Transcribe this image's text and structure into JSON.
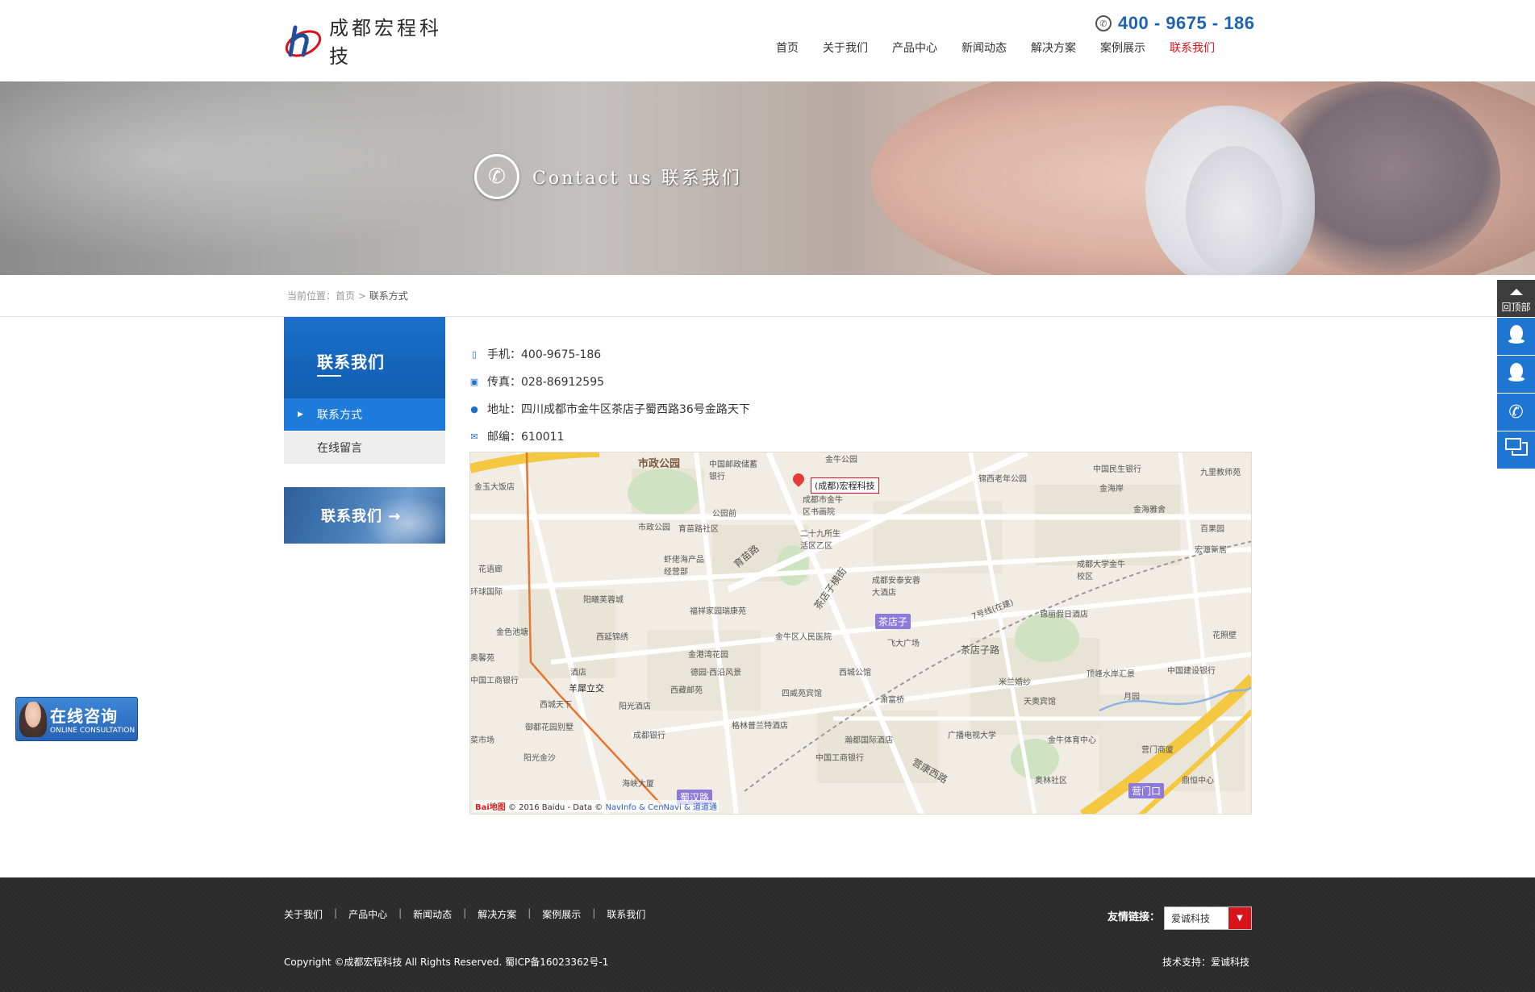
{
  "header": {
    "logo_text": "成都宏程科技",
    "hotline": "400 - 9675 - 186",
    "nav": [
      {
        "label": "首页"
      },
      {
        "label": "关于我们"
      },
      {
        "label": "产品中心"
      },
      {
        "label": "新闻动态"
      },
      {
        "label": "解决方案"
      },
      {
        "label": "案例展示"
      },
      {
        "label": "联系我们",
        "active": true
      }
    ]
  },
  "banner": {
    "title": "Contact us 联系我们"
  },
  "breadcrumb": {
    "prefix": "当前位置：",
    "home": "首页",
    "sep": ">",
    "current": "联系方式"
  },
  "sidebar": {
    "title": "联系我们",
    "items": [
      {
        "label": "联系方式",
        "active": true
      },
      {
        "label": "在线留言",
        "active": false
      }
    ],
    "cta": "联系我们 →"
  },
  "contact": {
    "mobile": "手机：400-9675-186",
    "fax": "传真：028-86912595",
    "address": "地址：四川成都市金牛区茶店子蜀西路36号金路天下",
    "postcode": "邮编：610011"
  },
  "map": {
    "marker": "(成都)宏程科技",
    "copyright_brand": "Bai地图",
    "copyright": "© 2016 Baidu - Data ©",
    "copyright_links": "NavInfo & CenNavi & 道道通",
    "labels": {
      "park": "市政公园",
      "l1": "中国邮政储蓄银行",
      "l2": "金牛公园",
      "l3": "锦西老年公园",
      "l4": "中国民生银行",
      "l5": "九里教师苑",
      "l6": "金海岸",
      "l7": "金海雅舍",
      "l8": "百果园",
      "l9": "宏源新居",
      "l10": "金玉大饭店",
      "l11": "成都市金牛区书画院",
      "l12": "公园前",
      "l13": "市政公园",
      "l14": "育苗路社区",
      "l15": "二十九所生活区乙区",
      "l16": "虾佬海产品经营部",
      "l17": "育苗路",
      "l18": "花语廊",
      "l19": "成都大学金牛校区",
      "l20": "环球国际",
      "l21": "阳曦芙蓉城",
      "l22": "福祥家园瑞康苑",
      "l23": "茶店子横街",
      "l24": "成都安泰安蓉大酒店",
      "l25": "锦丽假日酒店",
      "l26": "金色池塘",
      "l27": "西延锦绣",
      "l28": "金牛区人民医院",
      "l29": "飞大广场",
      "l30": "茶店子路",
      "l31": "花照壁",
      "l32": "奥馨苑",
      "l33": "金港湾花园",
      "l34": "德园·西沿风景",
      "l35": "西城公馆",
      "l36": "米兰婚纱",
      "l37": "顶峰水岸汇景",
      "l38": "中国建设银行",
      "l39": "中国工商银行",
      "l40": "羊犀立交",
      "l41": "酒店",
      "l42": "西藏邮苑",
      "l43": "四威苑宾馆",
      "l44": "渝富桥",
      "l45": "天奥宾馆",
      "l46": "月园",
      "l47": "西城天下",
      "l48": "阳光酒店",
      "l49": "御都花园别墅",
      "l50": "格林普兰特酒店",
      "l51": "广播电视大学",
      "l52": "金牛体育中心",
      "l53": "营门商厦",
      "l54": "菜市场",
      "l55": "成都银行",
      "l56": "瀚都国际酒店",
      "l57": "阳光金沙",
      "l58": "中国工商银行",
      "l59": "营康西路",
      "l60": "奥林社区",
      "l61": "鼎恒中心",
      "l62": "海峡大厦",
      "l63": "7号线(在建)"
    },
    "badges": {
      "b1": "茶店子",
      "b2": "蜀汉路",
      "b3": "营门口"
    }
  },
  "floating": {
    "online_title": "在线咨询",
    "online_sub": "ONLINE CONSULTATION",
    "back_top": "回顶部"
  },
  "footer": {
    "links": [
      "关于我们",
      "产品中心",
      "新闻动态",
      "解决方案",
      "案例展示",
      "联系我们"
    ],
    "separator": "|",
    "copyright": "Copyright ©成都宏程科技 All Rights Reserved. 蜀ICP备16023362号-1",
    "friend_label": "友情链接：",
    "friend_value": "爱诚科技",
    "tech_support": "技术支持：爱诚科技"
  },
  "colors": {
    "brand_blue": "#1d63b4",
    "active_red": "#d7141a",
    "sidebar_blue": "#1d7bdc",
    "footer_bg": "#2b2b2b"
  }
}
